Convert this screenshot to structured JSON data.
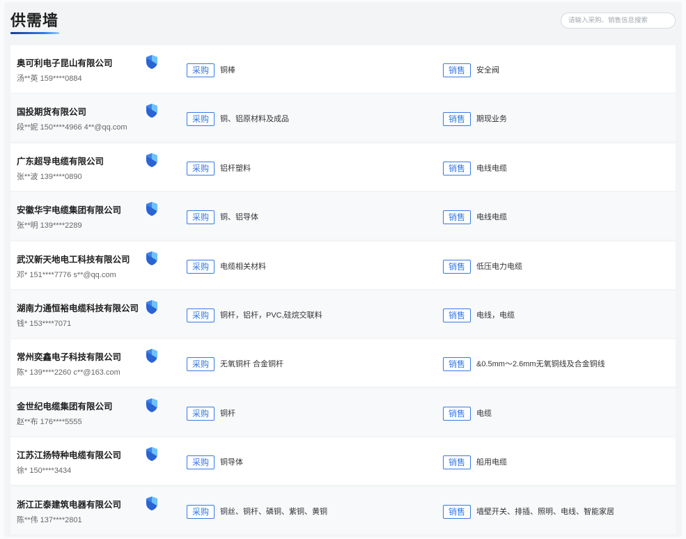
{
  "header": {
    "title": "供需墙"
  },
  "search": {
    "placeholder": "请输入采购、销售信息搜索"
  },
  "labels": {
    "purchase": "采购",
    "sale": "销售"
  },
  "icons": {
    "verified": "verified-shield-icon"
  },
  "colors": {
    "accent": "#3478e5",
    "row_alt": "#f8f9fb",
    "panel_bg": "#f3f4f6"
  },
  "rows": [
    {
      "company": "奥可利电子昆山有限公司",
      "contact": "汤**英 159****0884",
      "purchase": "铜棒",
      "sale": "安全阀"
    },
    {
      "company": "国投期货有限公司",
      "contact": "段**妮 150****4966 4**@qq.com",
      "purchase": "铜、铝原材料及成品",
      "sale": "期现业务"
    },
    {
      "company": "广东超导电缆有限公司",
      "contact": "张**波 139****0890",
      "purchase": "铝杆塑料",
      "sale": "电线电缆"
    },
    {
      "company": "安徽华宇电缆集团有限公司",
      "contact": "张**明 139****2289",
      "purchase": "铜、铝导体",
      "sale": "电线电缆"
    },
    {
      "company": "武汉新天地电工科技有限公司",
      "contact": "邓* 151****7776 s**@qq.com",
      "purchase": "电缆相关材料",
      "sale": "低压电力电缆"
    },
    {
      "company": "湖南力通恒裕电缆科技有限公司",
      "contact": "钱* 153****7071",
      "purchase": "铜杆，铝杆，PVC,硅烷交联料",
      "sale": "电线，电缆"
    },
    {
      "company": "常州奕鑫电子科技有限公司",
      "contact": "陈* 139****2260 c**@163.com",
      "purchase": "无氧铜杆 合金铜杆",
      "sale": "&0.5mm～2.6mm无氧铜线及合金铜线"
    },
    {
      "company": "金世纪电缆集团有限公司",
      "contact": "赵**布 176****5555",
      "purchase": "铜杆",
      "sale": "电缆"
    },
    {
      "company": "江苏江扬特种电缆有限公司",
      "contact": "徐* 150****3434",
      "purchase": "铜导体",
      "sale": "船用电缆"
    },
    {
      "company": "浙江正泰建筑电器有限公司",
      "contact": "陈**伟 137****2801",
      "purchase": "铜丝、铜杆、磷铜、紫铜、黄铜",
      "sale": "墙壁开关、排插、照明、电线、智能家居"
    }
  ]
}
